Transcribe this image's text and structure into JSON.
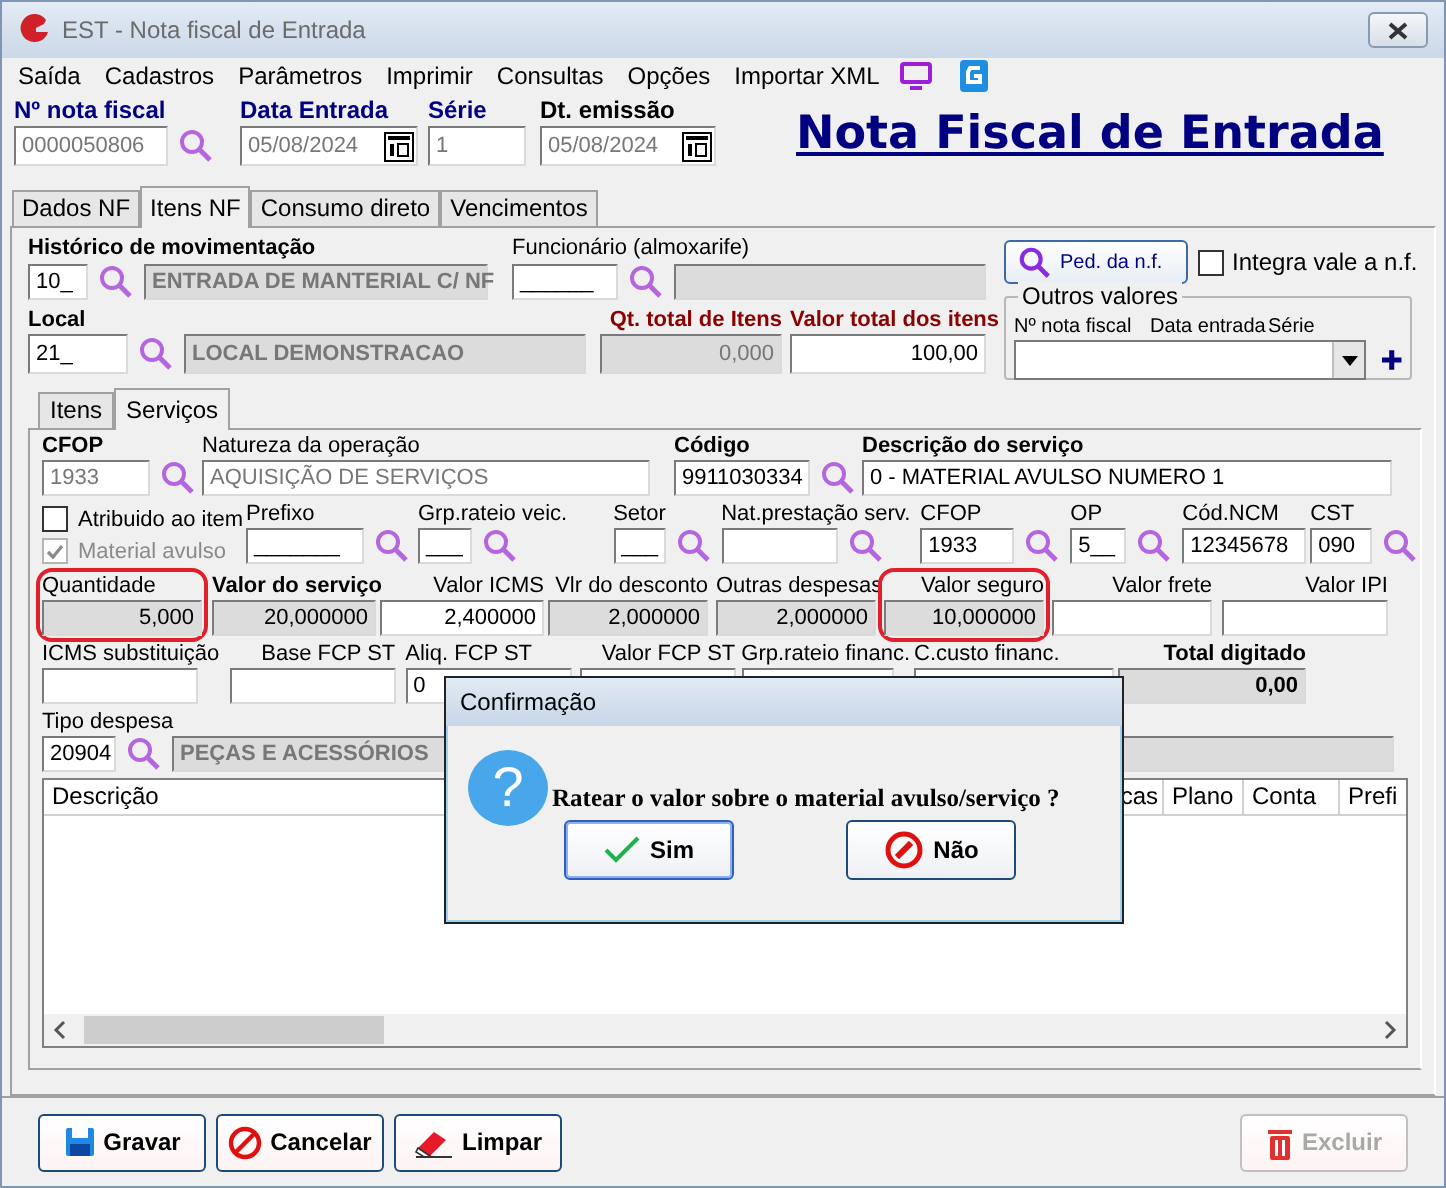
{
  "window": {
    "title": "EST - Nota fiscal de Entrada"
  },
  "menu": [
    "Saída",
    "Cadastros",
    "Parâmetros",
    "Imprimir",
    "Consultas",
    "Opções",
    "Importar XML"
  ],
  "header": {
    "fields": [
      {
        "label": "Nº nota fiscal",
        "value": "0000050806"
      },
      {
        "label": "Data Entrada",
        "value": "05/08/2024"
      },
      {
        "label": "Série",
        "value": "1"
      },
      {
        "label": "Dt. emissão",
        "value": "05/08/2024"
      }
    ],
    "title": "Nota Fiscal de Entrada"
  },
  "tabs": [
    {
      "label": "Dados NF",
      "selected": false
    },
    {
      "label": "Itens NF",
      "selected": true
    },
    {
      "label": "Consumo direto",
      "selected": false
    },
    {
      "label": "Vencimentos",
      "selected": false
    }
  ],
  "movimentacao": {
    "label": "Histórico de movimentação",
    "code": "10_",
    "description": "ENTRADA DE MANTERIAL C/ NF"
  },
  "funcionario": {
    "label": "Funcionário (almoxarife)",
    "code": "______"
  },
  "ped_button": "Ped. da n.f.",
  "integra_vale": {
    "label": "Integra vale a n.f.",
    "checked": false
  },
  "local": {
    "label": "Local",
    "code": "21_",
    "description": "LOCAL DEMONSTRACAO"
  },
  "totals": [
    {
      "label": "Qt. total de Itens",
      "value": "0,000",
      "disabled": true
    },
    {
      "label": "Valor total dos itens",
      "value": "100,00",
      "disabled": false
    }
  ],
  "outros_valores": {
    "title": "Outros valores",
    "columns": [
      "Nº nota fiscal",
      "Data entrada",
      "Série"
    ]
  },
  "subtabs": [
    {
      "label": "Itens",
      "selected": false
    },
    {
      "label": "Serviços",
      "selected": true
    }
  ],
  "servico": [
    {
      "label": "CFOP",
      "value": "1933"
    },
    {
      "label": "Natureza da operação",
      "value": "AQUISIÇÃO DE SERVIÇOS"
    },
    {
      "label": "Código",
      "value": "9911030334"
    },
    {
      "label": "Descrição do serviço",
      "value": "0 - MATERIAL AVULSO NUMERO 1"
    }
  ],
  "checks": [
    {
      "label": "Atribuido ao item",
      "checked": false,
      "disabled": false
    },
    {
      "label": "Material avulso",
      "checked": true,
      "disabled": true
    }
  ],
  "detail_fields": [
    {
      "label": "Prefixo",
      "value": "_______"
    },
    {
      "label": "Grp.rateio veic.",
      "value": "___"
    },
    {
      "label": "Setor",
      "value": "___"
    },
    {
      "label": "Nat.prestação serv."
    },
    {
      "label": "CFOP",
      "value": "1933"
    },
    {
      "label": "OP",
      "value": "5__"
    },
    {
      "label": "Cód.NCM",
      "value": "12345678"
    },
    {
      "label": "CST",
      "value": "090"
    }
  ],
  "values": [
    {
      "label": "Quantidade",
      "value": "5,000",
      "disabled": true,
      "highlighted": true
    },
    {
      "label": "Valor do serviço",
      "value": "20,000000",
      "disabled": true,
      "highlighted": false
    },
    {
      "label": "Valor ICMS",
      "value": "2,400000",
      "disabled": false,
      "highlighted": false
    },
    {
      "label": "Vlr do desconto",
      "value": "2,000000",
      "disabled": true,
      "highlighted": false
    },
    {
      "label": "Outras despesas",
      "value": "2,000000",
      "disabled": true,
      "highlighted": false
    },
    {
      "label": "Valor seguro",
      "value": "10,000000",
      "disabled": true,
      "highlighted": true
    },
    {
      "label": "Valor frete",
      "disabled": false,
      "highlighted": false
    },
    {
      "label": "Valor IPI",
      "disabled": false,
      "highlighted": false
    }
  ],
  "taxes": [
    {
      "label": "ICMS substituição"
    },
    {
      "label": "Base FCP ST"
    },
    {
      "label": "Aliq. FCP ST",
      "value": "0"
    },
    {
      "label": "Valor FCP ST"
    },
    {
      "label": "Grp.rateio financ."
    },
    {
      "label": "C.custo financ."
    },
    {
      "label": "Total digitado",
      "value": "0,00"
    }
  ],
  "tipo_despesa": {
    "label": "Tipo despesa",
    "code": "20904",
    "description": "PEÇAS E ACESSÓRIOS"
  },
  "table": {
    "columns": [
      "Descrição",
      "cas",
      "Plano",
      "Conta",
      "Prefi"
    ]
  },
  "buttons": [
    {
      "label": "Gravar",
      "kind": "save",
      "disabled": false
    },
    {
      "label": "Cancelar",
      "kind": "cancel",
      "disabled": false
    },
    {
      "label": "Limpar",
      "kind": "clear",
      "disabled": false
    },
    {
      "label": "Excluir",
      "kind": "delete",
      "disabled": true
    }
  ],
  "dialog": {
    "title": "Confirmação",
    "icon": "?",
    "message": "Ratear o valor sobre o material avulso/serviço ?",
    "buttons": [
      {
        "label": "Sim",
        "kind": "confirm"
      },
      {
        "label": "Não",
        "kind": "deny"
      }
    ]
  }
}
